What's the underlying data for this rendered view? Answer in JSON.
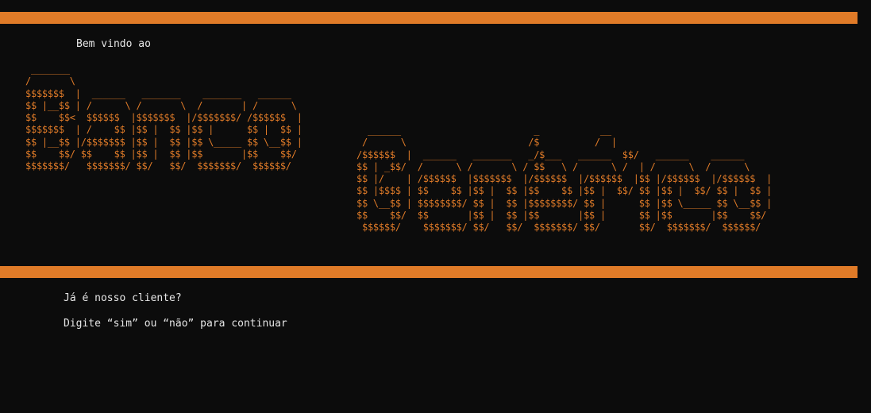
{
  "colors": {
    "background": "#0c0c0c",
    "accent": "#e07b28",
    "text": "#e6e6e6"
  },
  "header": {
    "welcome": "Bem vindo ao"
  },
  "banner": {
    "left_art": " _______\n/       \\\n$$$$$$$  |  ______   _______    _______   ______\n$$ |__$$ | /      \\ /       \\  /       | /      \\\n$$    $$<  $$$$$$  |$$$$$$$  |/$$$$$$$/ /$$$$$$  |\n$$$$$$$  | /    $$ |$$ |  $$ |$$ |      $$ |  $$ |\n$$ |__$$ |/$$$$$$$ |$$ |  $$ |$$ \\_____ $$ \\__$$ |\n$$    $$/ $$    $$ |$$ |  $$ |$$       |$$    $$/\n$$$$$$$/   $$$$$$$/ $$/   $$/  $$$$$$$/  $$$$$$/",
    "right_art": "  ______                        _           __\n /      \\                      /$          /  |\n/$$$$$$  |  ______   _______   _/$___   ______  $$/   ______    ______\n$$ | _$$/  /      \\ /       \\ / $$   \\ /      \\ /  | /      \\  /      \\\n$$ |/    | /$$$$$$  |$$$$$$$  |/$$$$$$  |/$$$$$$  |$$ |/$$$$$$  |/$$$$$$  |\n$$ |$$$$ | $$    $$ |$$ |  $$ |$$    $$ |$$ |  $$/ $$ |$$ |  $$/ $$ |  $$ |\n$$ \\__$$ | $$$$$$$$/ $$ |  $$ |$$$$$$$$/ $$ |      $$ |$$ \\_____ $$ \\__$$ |\n$$    $$/  $$       |$$ |  $$ |$$       |$$ |      $$ |$$       |$$    $$/\n $$$$$$/    $$$$$$$/ $$/   $$/  $$$$$$$/ $$/       $$/  $$$$$$$/  $$$$$$/"
  },
  "prompt": {
    "question": "Já é nosso cliente?",
    "instruction": "Digite “sim” ou “não” para continuar"
  }
}
